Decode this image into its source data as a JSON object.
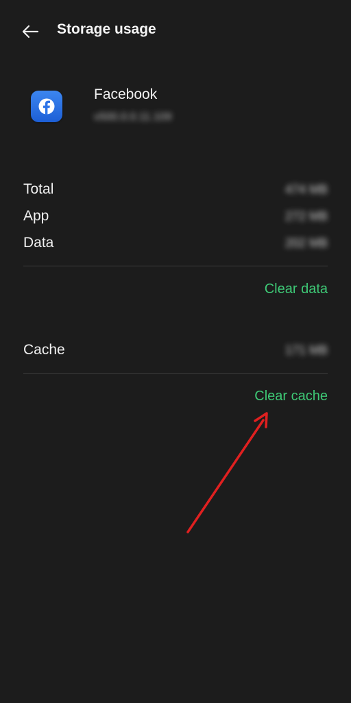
{
  "header": {
    "title": "Storage usage",
    "back_icon": "arrow-left-icon"
  },
  "app": {
    "name": "Facebook",
    "version": "v500.0.0.11.109",
    "icon": "facebook-icon",
    "icon_color": "#2d74e8"
  },
  "storage": {
    "total_label": "Total",
    "total_value": "474 MB",
    "app_label": "App",
    "app_value": "272 MB",
    "data_label": "Data",
    "data_value": "202 MB",
    "clear_data_label": "Clear data",
    "cache_label": "Cache",
    "cache_value": "171 MB",
    "clear_cache_label": "Clear cache"
  },
  "colors": {
    "background": "#1c1c1c",
    "accent": "#3ec976",
    "annotation_arrow": "#e02020"
  }
}
